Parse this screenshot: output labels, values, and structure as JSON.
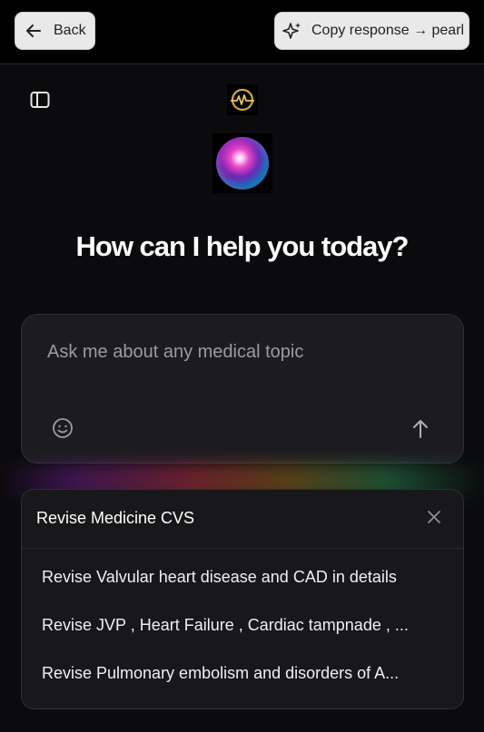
{
  "topbar": {
    "back_label": "Back",
    "copy_label": "Copy response → pearl"
  },
  "main": {
    "heading": "How can I help you today?",
    "input_placeholder": "Ask me about any medical topic"
  },
  "suggestions": {
    "title": "Revise Medicine CVS",
    "items": [
      "Revise Valvular heart disease and CAD in details",
      "Revise JVP , Heart Failure , Cardiac tampnade , ...",
      "Revise Pulmonary embolism and disorders of A..."
    ]
  },
  "icons": {
    "back": "arrow-left-icon",
    "copy": "sparkle-icon",
    "sidebar": "sidebar-toggle-icon",
    "brand": "brand-logo-icon",
    "emoji": "smiley-icon",
    "send": "arrow-up-icon",
    "close": "close-icon"
  },
  "colors": {
    "background": "#0b0b0d",
    "card": "#1c1c20",
    "button": "#e9e9e9",
    "brand_gold": "#d9a441"
  }
}
